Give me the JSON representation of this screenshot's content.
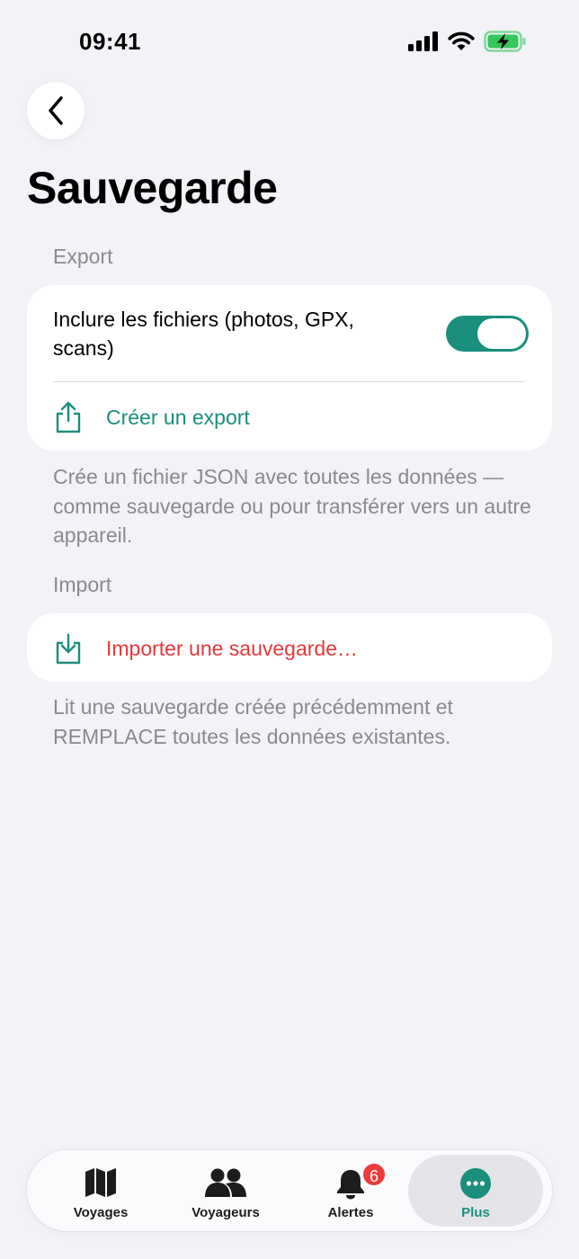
{
  "status_bar": {
    "time": "09:41",
    "icons": [
      "signal-icon",
      "wifi-icon",
      "battery-charging-icon"
    ]
  },
  "header": {
    "back_icon": "chevron-left-icon",
    "title": "Sauvegarde"
  },
  "export_section": {
    "header": "Export",
    "toggle_label": "Inclure les fichiers (photos, GPX, scans)",
    "toggle_on": true,
    "action_label": "Créer un export",
    "action_icon": "share-upload-icon",
    "footnote": "Crée un fichier JSON avec toutes les données — comme sauvegarde ou pour transférer vers un autre appareil."
  },
  "import_section": {
    "header": "Import",
    "action_label": "Importer une sauvegarde…",
    "action_icon": "download-tray-icon",
    "footnote": "Lit une sauvegarde créée précédemment et REMPLACE toutes les données existantes."
  },
  "tab_bar": {
    "tabs": [
      {
        "label": "Voyages",
        "icon": "map-icon",
        "active": false
      },
      {
        "label": "Voyageurs",
        "icon": "people-icon",
        "active": false
      },
      {
        "label": "Alertes",
        "icon": "bell-icon",
        "active": false,
        "badge": "6"
      },
      {
        "label": "Plus",
        "icon": "more-icon",
        "active": true
      }
    ]
  },
  "colors": {
    "accent": "#1a8f7d",
    "destructive": "#e5383b",
    "background": "#f2f2f7",
    "secondary_text": "#8a8a8e",
    "badge": "#ef3b3b"
  }
}
